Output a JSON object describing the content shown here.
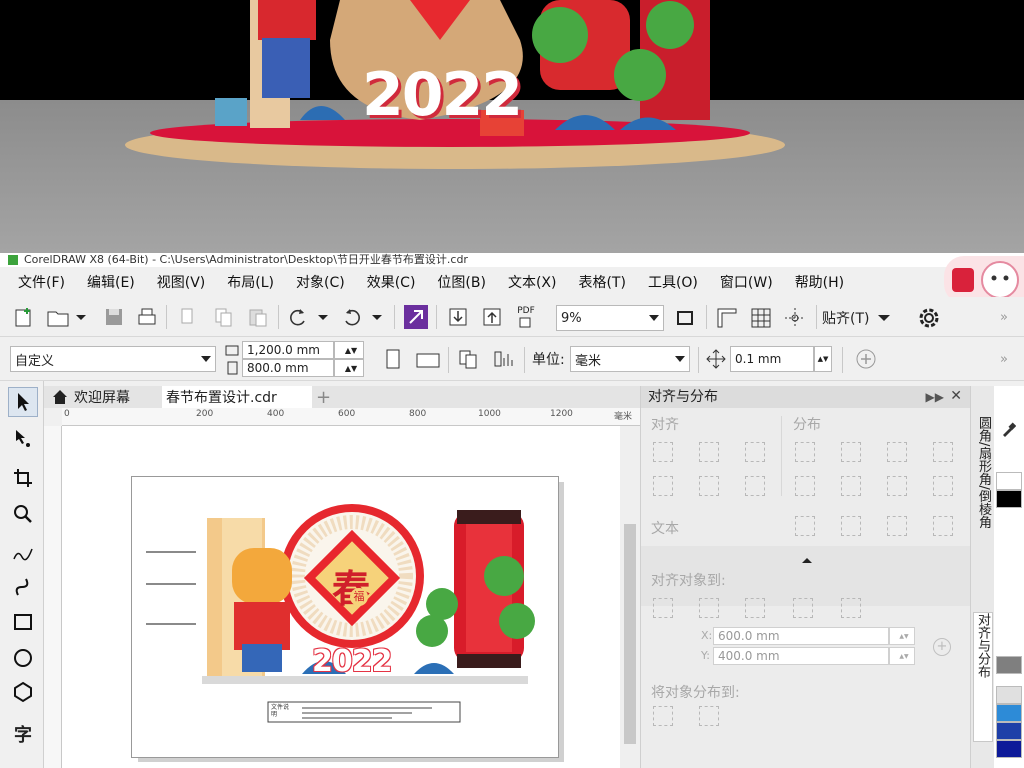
{
  "window": {
    "title": "CorelDRAW X8 (64-Bit) - C:\\Users\\Administrator\\Desktop\\节日开业春节布置设计.cdr"
  },
  "render": {
    "number": "2022"
  },
  "menu": [
    "文件(F)",
    "编辑(E)",
    "视图(V)",
    "布局(L)",
    "对象(C)",
    "效果(C)",
    "位图(B)",
    "文本(X)",
    "表格(T)",
    "工具(O)",
    "窗口(W)",
    "帮助(H)"
  ],
  "toolbar": {
    "zoom": "9%",
    "snap_label": "贴齐(T)"
  },
  "propertybar": {
    "preset": "自定义",
    "width": "1,200.0 mm",
    "height": "800.0 mm",
    "units_label": "单位:",
    "units_value": "毫米",
    "nudge": "0.1 mm"
  },
  "tabs": {
    "welcome": "欢迎屏幕",
    "document": "春节布置设计.cdr",
    "add": "+"
  },
  "ruler": {
    "ticks": [
      "0",
      "200",
      "400",
      "600",
      "800",
      "1000",
      "1200"
    ],
    "unit": "毫米"
  },
  "artwork": {
    "number": "2022",
    "center_char": "春",
    "badge_char": "福",
    "note_label": "文件说明"
  },
  "docker": {
    "title": "对齐与分布",
    "align": "对齐",
    "distribute": "分布",
    "text": "文本",
    "align_to": "对齐对象到:",
    "x": "600.0 mm",
    "y": "400.0 mm",
    "distribute_to": "将对象分布到:"
  },
  "docker_tabs": [
    "圆角/扇形角/倒棱角",
    "对齐与分布"
  ],
  "palette": [
    "#ffffff",
    "#000000",
    "#7f7f7f",
    "#e0e0e0",
    "#2d8bd7",
    "#1e3fa8",
    "#0d1a99"
  ]
}
